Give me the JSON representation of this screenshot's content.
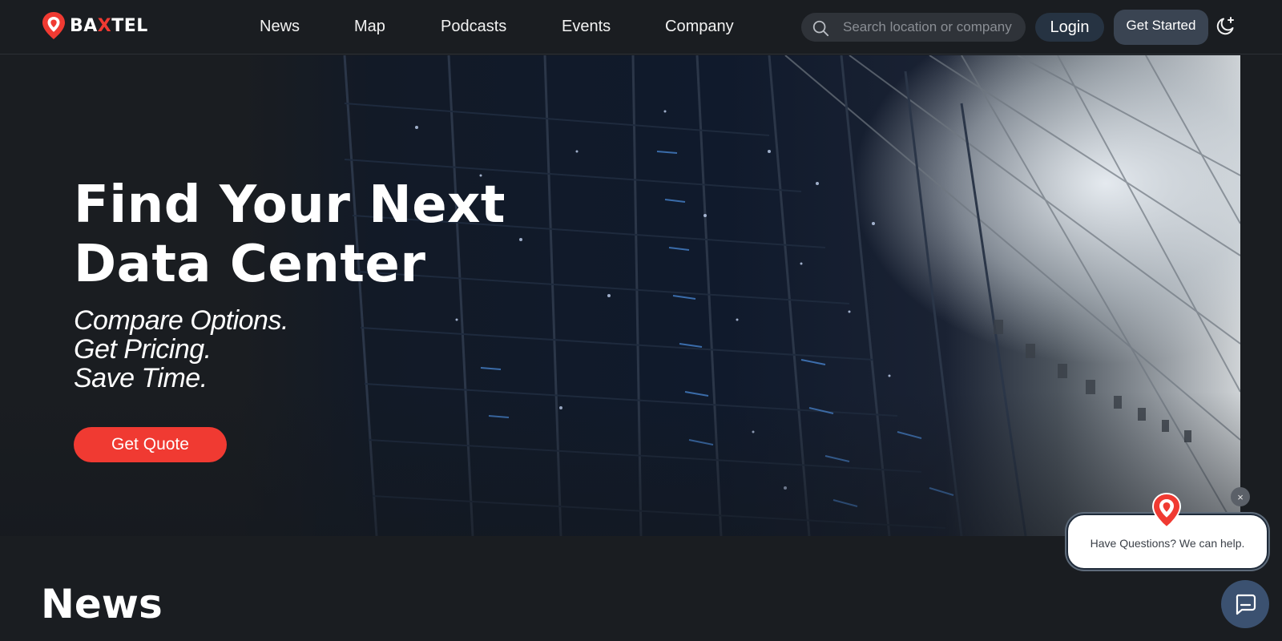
{
  "brand": {
    "name_prefix": "BA",
    "name_x": "X",
    "name_suffix": "TEL",
    "accent_color": "#f03a32",
    "logo_icon": "map-pin-icon"
  },
  "nav": {
    "links": [
      "News",
      "Map",
      "Podcasts",
      "Events",
      "Company"
    ],
    "search": {
      "placeholder": "Search location or company",
      "value": "",
      "icon": "search-icon"
    },
    "login_label": "Login",
    "get_started_label": "Get Started",
    "theme_icon": "moon-sparkle-icon"
  },
  "hero": {
    "title_line1": "Find Your Next",
    "title_line2": "Data Center",
    "subtitle_lines": [
      "Compare Options.",
      "Get Pricing.",
      "Save Time."
    ],
    "cta_label": "Get Quote"
  },
  "news": {
    "heading": "News"
  },
  "chat": {
    "close_label": "×",
    "message": "Have Questions? We can help.",
    "launcher_icon": "chat-bubble-icon"
  }
}
